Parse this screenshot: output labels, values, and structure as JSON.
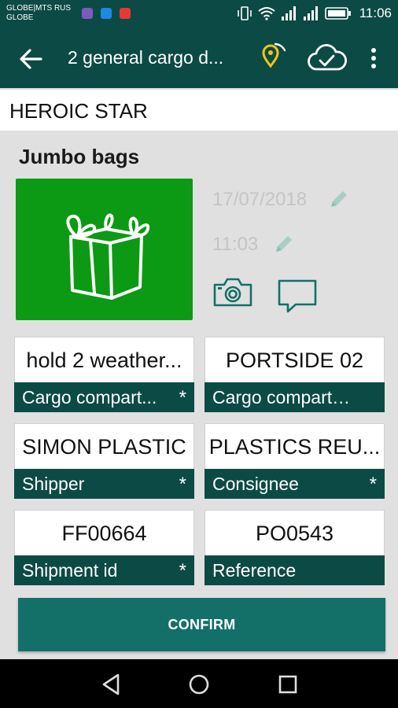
{
  "status_bar": {
    "carrier_line1": "GLOBE|MTS RUS",
    "carrier_line2": "GLOBE",
    "time": "11:06"
  },
  "app_bar": {
    "title": "2 general cargo d...",
    "icons": [
      "back-arrow-icon",
      "location-pin-icon",
      "cloud-check-icon",
      "more-vert-icon"
    ],
    "accent_color": "#f3c317"
  },
  "vessel_name": "HEROIC STAR",
  "cargo": {
    "type": "Jumbo bags",
    "icon": "jumbo-bag-icon",
    "tile_color": "#0c9a14",
    "date": "17/07/2018",
    "time": "11:03"
  },
  "fields": [
    {
      "value": "hold 2 weather...",
      "label": "Cargo compart...",
      "required": "*"
    },
    {
      "value": "PORTSIDE 02",
      "label": "Cargo compartm...",
      "required": ""
    },
    {
      "value": "SIMON PLASTIC",
      "label": "Shipper",
      "required": "*"
    },
    {
      "value": "PLASTICS REU...",
      "label": "Consignee",
      "required": "*"
    },
    {
      "value": "FF00664",
      "label": "Shipment id",
      "required": "*"
    },
    {
      "value": "PO0543",
      "label": "Reference",
      "required": ""
    }
  ],
  "confirm_label": "CONFIRM",
  "theme": {
    "primary": "#0c4a45",
    "button": "#137068"
  }
}
